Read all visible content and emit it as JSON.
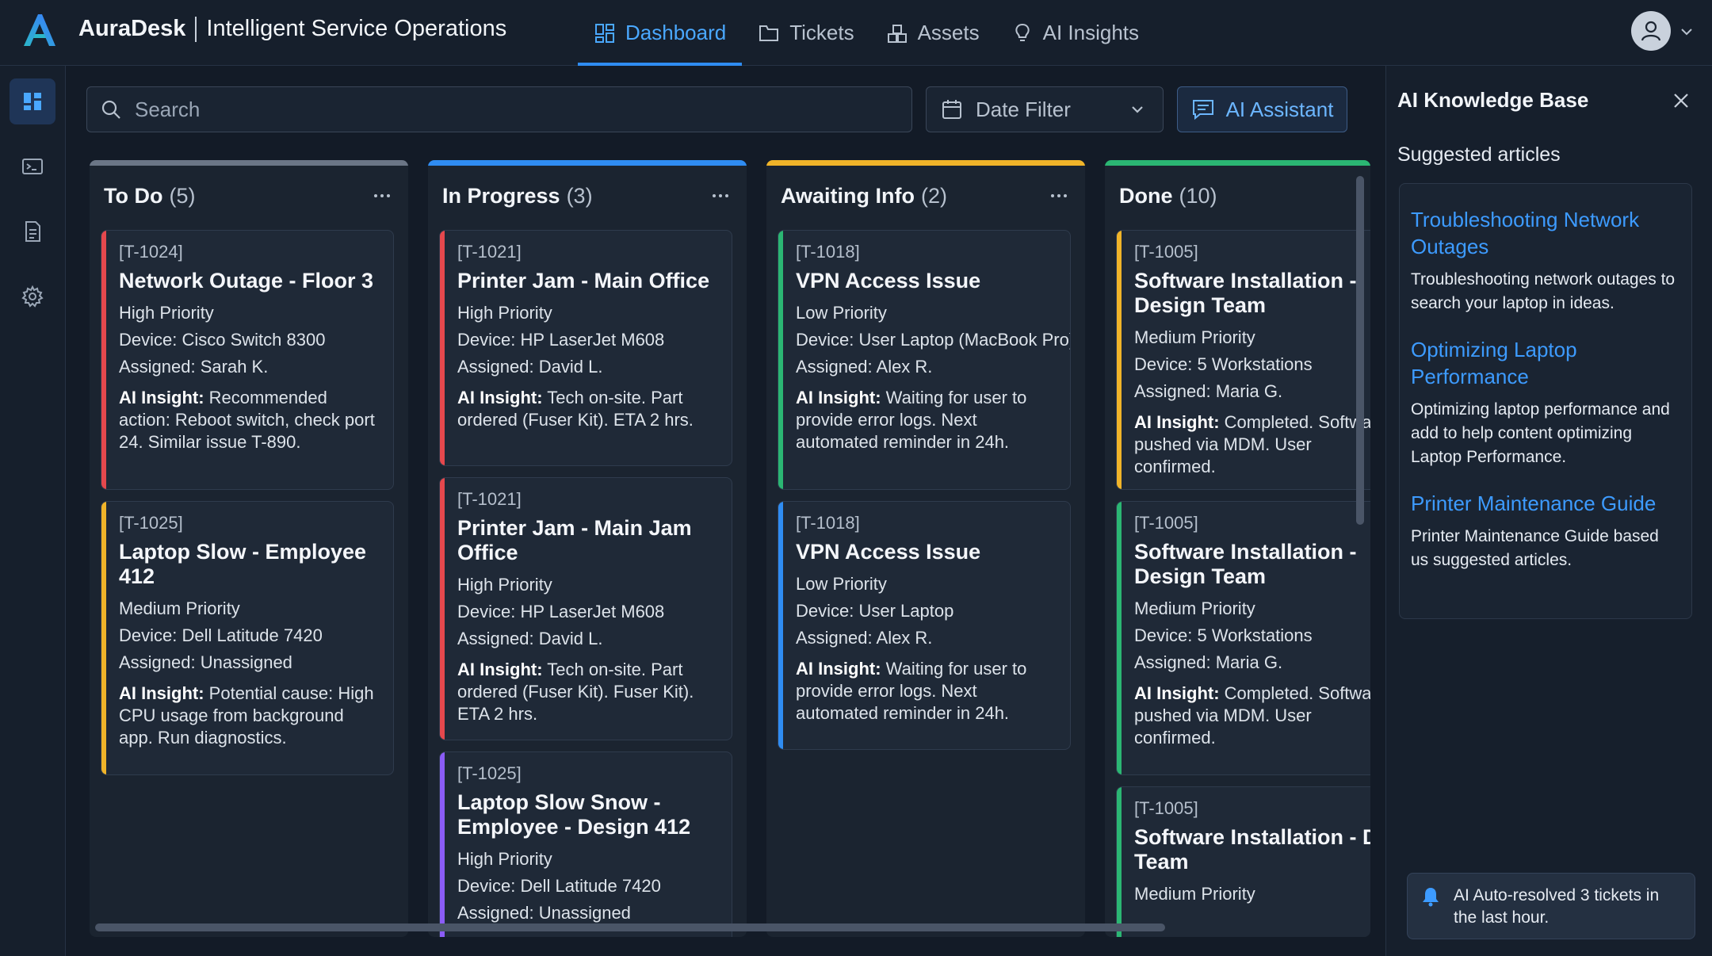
{
  "app": {
    "brand_name": "AuraDesk",
    "brand_subtitle": "Intelligent Service Operations",
    "colors": {
      "background": "#131b27",
      "accent": "#2f8cf2",
      "todo": "#6b7686",
      "in_progress": "#2f8cf2",
      "awaiting": "#f0b429",
      "done": "#2bb673",
      "priority_high": "#e5484d",
      "priority_medium": "#f0b429",
      "priority_low": "#2bb673",
      "purple": "#8b5cf6"
    }
  },
  "nav": {
    "dashboard": "Dashboard",
    "tickets": "Tickets",
    "assets": "Assets",
    "ai_insights": "AI Insights"
  },
  "rail": {
    "icons": [
      "dashboard-grid-icon",
      "terminal-icon",
      "document-icon",
      "settings-gear-icon"
    ]
  },
  "toolbar": {
    "search_placeholder": "Search",
    "date_filter": "Date Filter",
    "ai_assistant": "AI Assistant"
  },
  "columns": [
    {
      "title": "To Do",
      "count": "(5)",
      "cards": [
        {
          "id": "[T-1024]",
          "title": "Network Outage - Floor 3",
          "priority": "High Priority",
          "device": "Device: Cisco Switch 8300",
          "assigned": "Assigned: Sarah K.",
          "insight_label": "AI Insight:",
          "insight": "Recommended action: Reboot switch, check port 24. Similar issue T-890."
        },
        {
          "id": "[T-1025]",
          "title": "Laptop Slow - Employee 412",
          "priority": "Medium Priority",
          "device": "Device: Dell Latitude 7420",
          "assigned": "Assigned: Unassigned",
          "insight_label": "AI Insight:",
          "insight": "Potential cause: High CPU usage from background app. Run diagnostics."
        }
      ]
    },
    {
      "title": "In Progress",
      "count": "(3)",
      "cards": [
        {
          "id": "[T-1021]",
          "title": "Printer Jam - Main Office",
          "priority": "High Priority",
          "device": "Device: HP LaserJet M608",
          "assigned": "Assigned: David L.",
          "insight_label": "AI Insight:",
          "insight": "Tech on-site. Part ordered (Fuser Kit). ETA 2 hrs."
        },
        {
          "id": "[T-1021]",
          "title": "Printer Jam - Main Jam Office",
          "priority": "High Priority",
          "device": "Device: HP LaserJet M608",
          "assigned": "Assigned: David L.",
          "insight_label": "AI Insight:",
          "insight": "Tech on-site. Part ordered (Fuser Kit). Fuser Kit). ETA 2 hrs."
        },
        {
          "id": "[T-1025]",
          "title": "Laptop Slow Snow - Employee - Design 412",
          "priority": "High Priority",
          "device": "Device: Dell Latitude 7420",
          "assigned": "Assigned: Unassigned"
        }
      ]
    },
    {
      "title": "Awaiting Info",
      "count": "(2)",
      "cards": [
        {
          "id": "[T-1018]",
          "title": "VPN Access Issue",
          "priority": "Low Priority",
          "device": "Device: User Laptop (MacBook Pro)",
          "assigned": "Assigned: Alex R.",
          "insight_label": "AI Insight:",
          "insight": "Waiting for user to provide error logs. Next automated reminder in 24h."
        },
        {
          "id": "[T-1018]",
          "title": "VPN Access Issue",
          "priority": "Low Priority",
          "device": "Device: User Laptop",
          "assigned": "Assigned: Alex R.",
          "insight_label": "AI Insight:",
          "insight": "Waiting for user to provide error logs. Next automated reminder in 24h."
        }
      ]
    },
    {
      "title": "Done",
      "count": "(10)",
      "cards": [
        {
          "id": "[T-1005]",
          "title": "Software Installation - Design Team",
          "priority": "Medium Priority",
          "device": "Device: 5 Workstations",
          "assigned": "Assigned: Maria G.",
          "insight_label": "AI Insight:",
          "insight": "Completed. Software pushed via MDM. User confirmed."
        },
        {
          "id": "[T-1005]",
          "title": "Software Installation - Design Team",
          "priority": "Medium Priority",
          "device": "Device: 5 Workstations",
          "assigned": "Assigned: Maria G.",
          "insight_label": "AI Insight:",
          "insight": "Completed. Software pushed via MDM. User confirmed."
        },
        {
          "id": "[T-1005]",
          "title": "Software Installation - De Team",
          "priority": "Medium Priority"
        }
      ]
    }
  ],
  "panel": {
    "title": "AI Knowledge Base",
    "subtitle": "Suggested articles",
    "articles": [
      {
        "title": "Troubleshooting Network Outages",
        "desc": "Troubleshooting network outages to search your laptop in ideas."
      },
      {
        "title": "Optimizing Laptop Performance",
        "desc": "Optimizing laptop performance and add to help content optimizing Laptop Performance."
      },
      {
        "title": "Printer Maintenance Guide",
        "desc": "Printer Maintenance Guide based us suggested articles."
      }
    ],
    "toast": "AI Auto-resolved 3 tickets in the last hour."
  }
}
